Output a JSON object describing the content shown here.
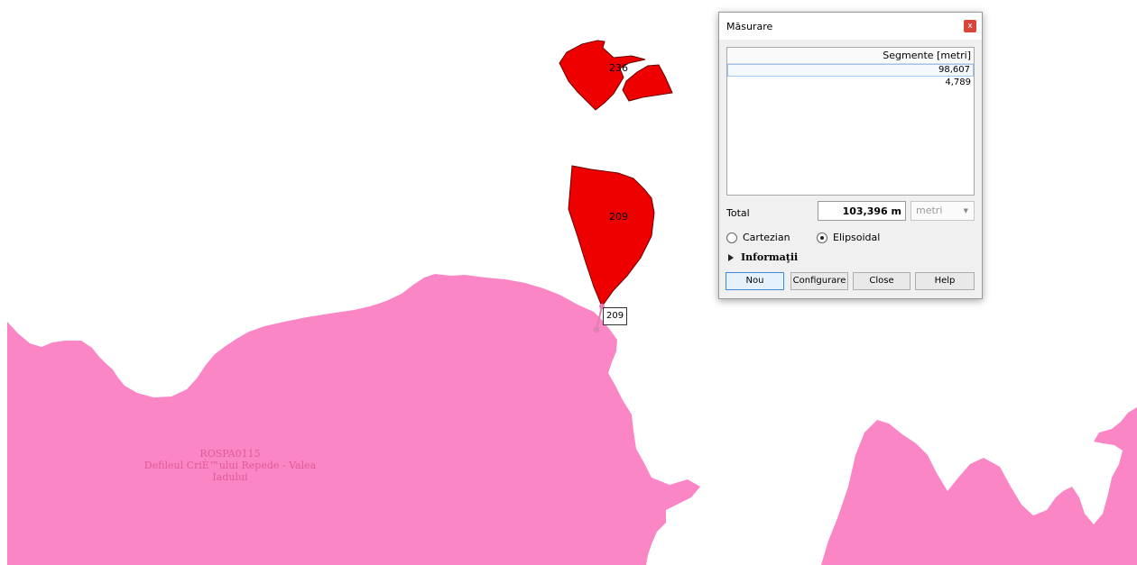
{
  "map": {
    "protected_area_code": "ROSPA0115",
    "protected_area_name": "Defileul CriÈ™ului Repede - Valea Iadului",
    "parcel_labels": [
      "236",
      "209"
    ],
    "tooltip": "209",
    "colors": {
      "parcel": "#ee0000",
      "area": "#fb86c6",
      "label": "#e05a9a"
    }
  },
  "dialog": {
    "title": "Măsurare",
    "close_label": "x",
    "table": {
      "header": "Segmente [metri]",
      "rows": [
        "98,607",
        "4,789"
      ]
    },
    "total_label": "Total",
    "total_value": "103,396 m",
    "unit_value": "metri",
    "radios": [
      {
        "label": "Cartezian",
        "checked": false
      },
      {
        "label": "Elipsoidal",
        "checked": true
      }
    ],
    "info_label": "Informaţii",
    "buttons": [
      "Nou",
      "Configurare",
      "Close",
      "Help"
    ]
  }
}
